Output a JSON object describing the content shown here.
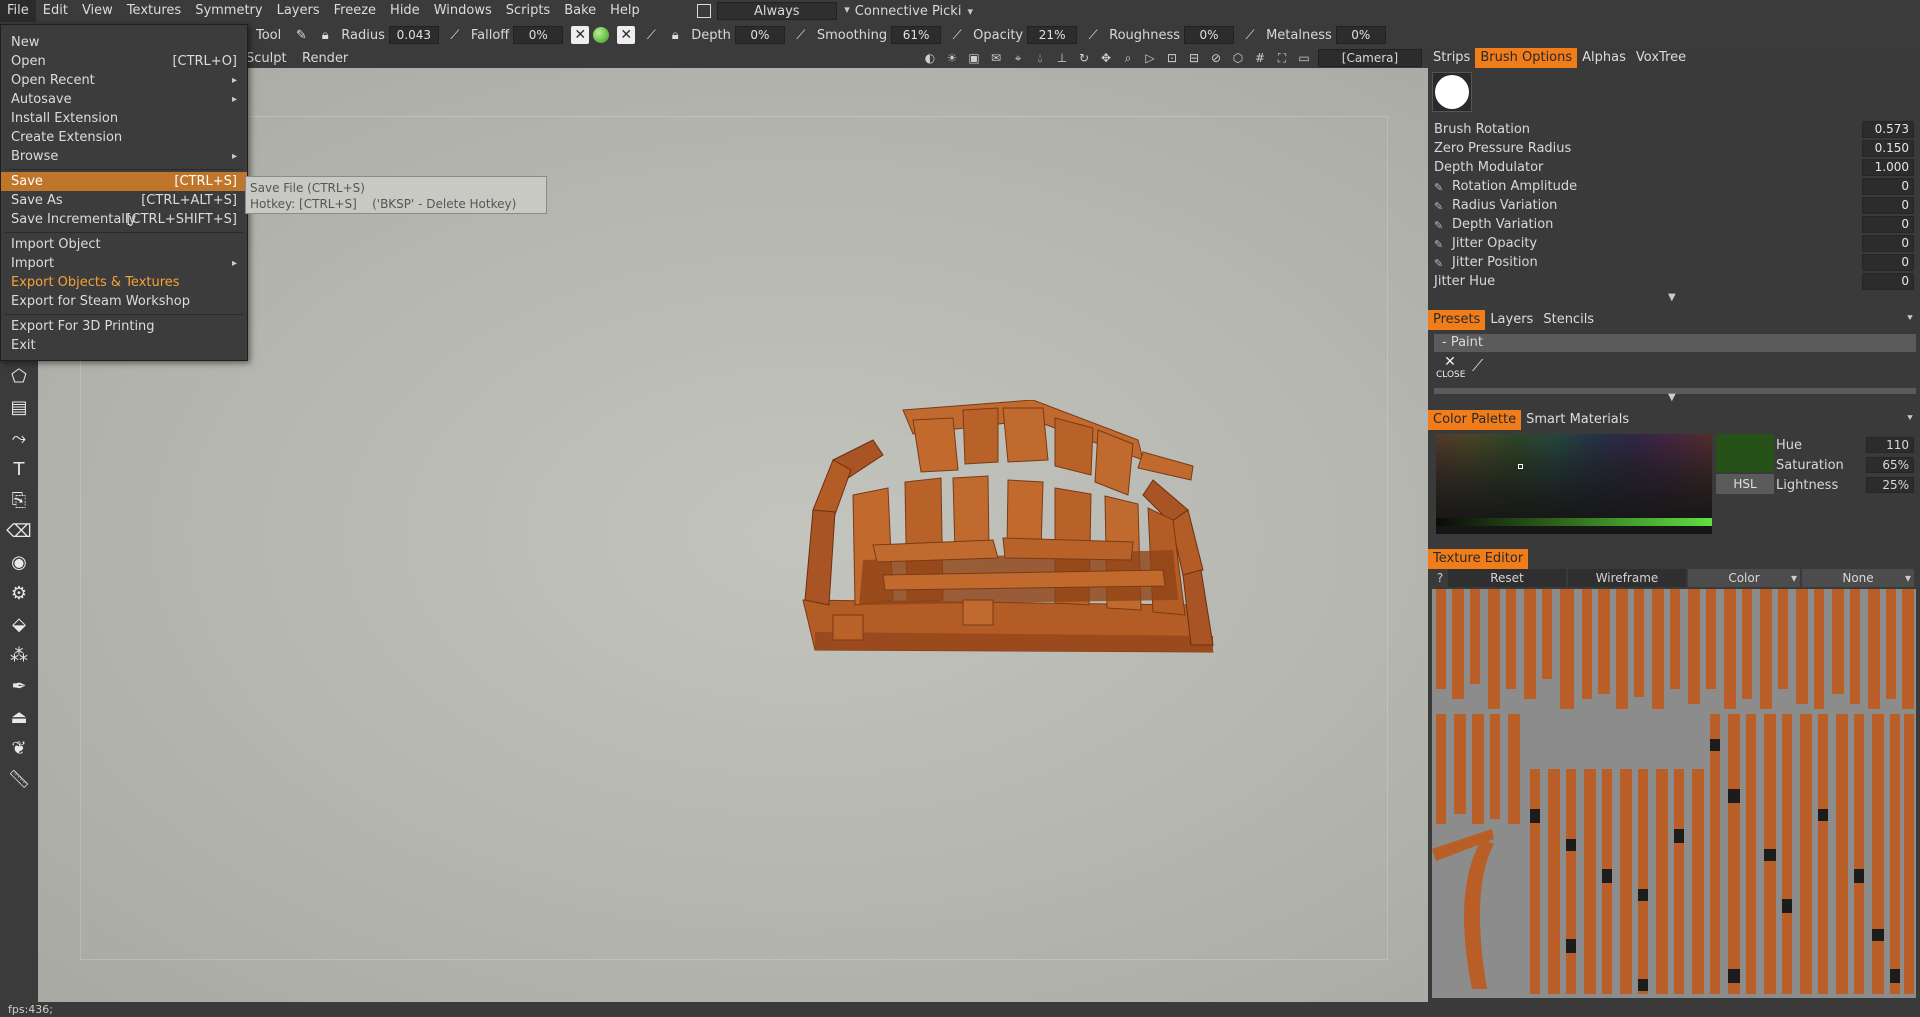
{
  "menubar": {
    "items": [
      "File",
      "Edit",
      "View",
      "Textures",
      "Symmetry",
      "Layers",
      "Freeze",
      "Hide",
      "Windows",
      "Scripts",
      "Bake",
      "Help"
    ],
    "always_label": "Always",
    "connective_label": "Connective  Picki"
  },
  "toolbar2": {
    "tool_label": "Tool",
    "radius_label": "Radius",
    "radius_value": "0.043",
    "falloff_label": "Falloff",
    "falloff_value": "0%",
    "depth_label": "Depth",
    "depth_value": "0%",
    "smoothing_label": "Smoothing",
    "smoothing_value": "61%",
    "opacity_label": "Opacity",
    "opacity_value": "21%",
    "roughness_label": "Roughness",
    "roughness_value": "0%",
    "metalness_label": "Metalness",
    "metalness_value": "0%"
  },
  "toolbar3": {
    "sculpt_label": "Sculpt",
    "render_label": "Render",
    "camera_value": "[Camera]"
  },
  "file_menu": {
    "items": [
      {
        "label": "New",
        "shortcut": "",
        "submenu": false
      },
      {
        "label": "Open",
        "shortcut": "[CTRL+O]",
        "submenu": false
      },
      {
        "label": "Open Recent",
        "shortcut": "",
        "submenu": true
      },
      {
        "label": "Autosave",
        "shortcut": "",
        "submenu": true
      },
      {
        "label": "Install Extension",
        "shortcut": "",
        "submenu": false
      },
      {
        "label": "Create Extension",
        "shortcut": "",
        "submenu": false
      },
      {
        "label": "Browse",
        "shortcut": "",
        "submenu": true
      },
      {
        "label": "Save",
        "shortcut": "[CTRL+S]",
        "submenu": false
      },
      {
        "label": "Save As",
        "shortcut": "[CTRL+ALT+S]",
        "submenu": false
      },
      {
        "label": "Save Incrementally",
        "shortcut": "[CTRL+SHIFT+S]",
        "submenu": false
      },
      {
        "label": "Import Object",
        "shortcut": "",
        "submenu": false
      },
      {
        "label": "Import",
        "shortcut": "",
        "submenu": true
      },
      {
        "label": "Export Objects & Textures",
        "shortcut": "",
        "submenu": false
      },
      {
        "label": "Export for Steam Workshop",
        "shortcut": "",
        "submenu": false
      },
      {
        "label": "Export For 3D Printing",
        "shortcut": "",
        "submenu": false
      },
      {
        "label": "Exit",
        "shortcut": "",
        "submenu": false
      }
    ],
    "highlighted": "Save"
  },
  "tooltip": {
    "line1": "Save File (CTRL+S)",
    "line2": "Hotkey: [CTRL+S]    ('BKSP' - Delete Hotkey)"
  },
  "brush_panel": {
    "tabs": [
      "Strips",
      "Brush Options",
      "Alphas",
      "VoxTree"
    ],
    "active_tab": "Brush Options",
    "rows": [
      {
        "label": "Brush Rotation",
        "value": "0.573",
        "pen": false
      },
      {
        "label": "Zero Pressure Radius",
        "value": "0.150",
        "pen": false
      },
      {
        "label": "Depth Modulator",
        "value": "1.000",
        "pen": false
      },
      {
        "label": "Rotation Amplitude",
        "value": "0",
        "pen": true
      },
      {
        "label": "Radius Variation",
        "value": "0",
        "pen": true
      },
      {
        "label": "Depth Variation",
        "value": "0",
        "pen": true
      },
      {
        "label": "Jitter Opacity",
        "value": "0",
        "pen": true
      },
      {
        "label": "Jitter Position",
        "value": "0",
        "pen": true
      },
      {
        "label": "Jitter Hue",
        "value": "0",
        "pen": false
      }
    ]
  },
  "presets_panel": {
    "tabs": [
      "Presets",
      "Layers",
      "Stencils"
    ],
    "active_tab": "Presets",
    "header": "-  Paint",
    "close_label": "CLOSE"
  },
  "palette_panel": {
    "tabs": [
      "Color Palette",
      "Smart Materials"
    ],
    "active_tab": "Color Palette",
    "hsl_label": "HSL",
    "hue_label": "Hue",
    "hue_value": "110",
    "saturation_label": "Saturation",
    "saturation_value": "65%",
    "lightness_label": "Lightness",
    "lightness_value": "25%",
    "current_color": "#26521a"
  },
  "texture_editor": {
    "tabs": [
      "Texture Editor"
    ],
    "question": "?",
    "reset_label": "Reset",
    "wireframe_label": "Wireframe",
    "channel_value": "Color",
    "overlay_value": "None"
  },
  "status": {
    "fps": "fps:436;"
  },
  "colors": {
    "accent": "#f07c1a",
    "menu_highlight": "#c0762a",
    "wood": "#b5602c"
  }
}
